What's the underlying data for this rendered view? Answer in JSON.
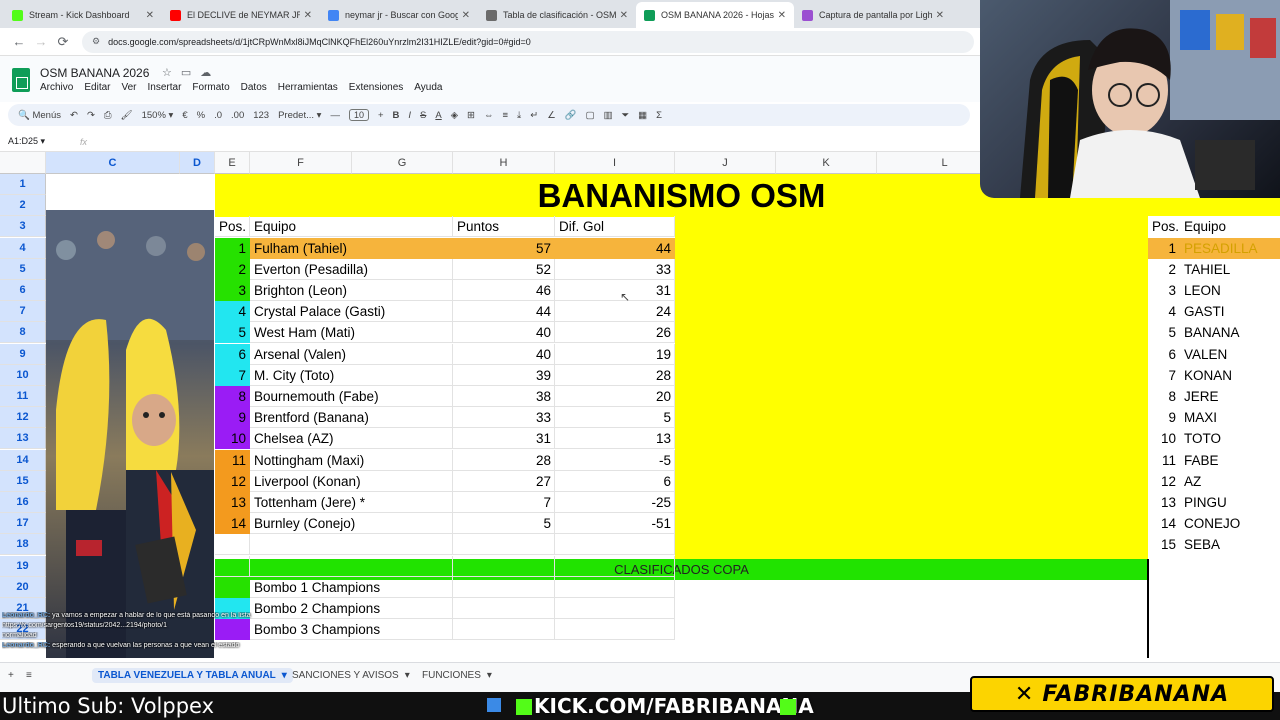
{
  "browser": {
    "tabs": [
      {
        "label": "Stream - Kick Dashboard",
        "color": "#53fc18",
        "active": false
      },
      {
        "label": "El DECLIVE de NEYMAR JR 😱",
        "color": "#ff0000",
        "active": false
      },
      {
        "label": "neymar jr - Buscar con Google",
        "color": "#4285f4",
        "active": false
      },
      {
        "label": "Tabla de clasificación - OSM",
        "color": "#6b6b6b",
        "active": false
      },
      {
        "label": "OSM BANANA 2026 - Hojas de",
        "color": "#0f9d58",
        "active": true
      },
      {
        "label": "Captura de pantalla por Lightsh",
        "color": "#9b4fd1",
        "active": false
      }
    ],
    "url": "docs.google.com/spreadsheets/d/1jtCRpWnMxl8iJMqClNKQFhEl260uYnrzlm2I31HIZLE/edit?gid=0#gid=0"
  },
  "doc": {
    "title": "OSM BANANA 2026",
    "menu": [
      "Archivo",
      "Editar",
      "Ver",
      "Insertar",
      "Formato",
      "Datos",
      "Herramientas",
      "Extensiones",
      "Ayuda"
    ]
  },
  "toolbar": {
    "menus_label": "Menús",
    "zoom": "150%",
    "currency": "€",
    "percent": "%",
    "dec_less": ".0",
    "dec_more": ".00",
    "number_format": "123",
    "font": "Predet...",
    "font_size": "10"
  },
  "formula": {
    "namebox": "A1:D25",
    "fx": "fx"
  },
  "columns": [
    "C",
    "D",
    "E",
    "F",
    "G",
    "H",
    "I",
    "J",
    "K",
    "L"
  ],
  "rows": [
    "1",
    "2",
    "3",
    "4",
    "5",
    "6",
    "7",
    "8",
    "9",
    "10",
    "11",
    "12",
    "13",
    "14",
    "15",
    "16",
    "17",
    "18",
    "19",
    "20",
    "21",
    "22"
  ],
  "sheet": {
    "banner": "BANANISMO OSM",
    "headers": {
      "pos": "Pos.",
      "team": "Equipo",
      "points": "Puntos",
      "goal_diff": "Dif. Gol"
    },
    "standings": [
      {
        "pos": "1",
        "team": "Fulham (Tahiel)",
        "points": "57",
        "gd": "44",
        "color": "#26e100"
      },
      {
        "pos": "2",
        "team": "Everton (Pesadilla)",
        "points": "52",
        "gd": "33",
        "color": "#26e100"
      },
      {
        "pos": "3",
        "team": "Brighton (Leon)",
        "points": "46",
        "gd": "31",
        "color": "#26e100"
      },
      {
        "pos": "4",
        "team": "Crystal Palace (Gasti)",
        "points": "44",
        "gd": "24",
        "color": "#22e6f0"
      },
      {
        "pos": "5",
        "team": "West Ham (Mati)",
        "points": "40",
        "gd": "26",
        "color": "#22e6f0"
      },
      {
        "pos": "6",
        "team": "Arsenal (Valen)",
        "points": "40",
        "gd": "19",
        "color": "#22e6f0"
      },
      {
        "pos": "7",
        "team": "M. City (Toto)",
        "points": "39",
        "gd": "28",
        "color": "#22e6f0"
      },
      {
        "pos": "8",
        "team": "Bournemouth (Fabe)",
        "points": "38",
        "gd": "20",
        "color": "#9a1cf5"
      },
      {
        "pos": "9",
        "team": "Brentford (Banana)",
        "points": "33",
        "gd": "5",
        "color": "#9a1cf5"
      },
      {
        "pos": "10",
        "team": "Chelsea (AZ)",
        "points": "31",
        "gd": "13",
        "color": "#9a1cf5"
      },
      {
        "pos": "11",
        "team": "Nottingham (Maxi)",
        "points": "28",
        "gd": "-5",
        "color": "#f39a1e"
      },
      {
        "pos": "12",
        "team": "Liverpool (Konan)",
        "points": "27",
        "gd": "6",
        "color": "#f39a1e"
      },
      {
        "pos": "13",
        "team": "Tottenham (Jere) *",
        "points": "7",
        "gd": "-25",
        "color": "#f39a1e"
      },
      {
        "pos": "14",
        "team": "Burnley (Conejo)",
        "points": "5",
        "gd": "-51",
        "color": "#f39a1e"
      }
    ],
    "ranking_headers": {
      "pos": "Pos.",
      "team": "Equipo"
    },
    "ranking": [
      {
        "pos": "1",
        "name": "PESADILLA"
      },
      {
        "pos": "2",
        "name": "TAHIEL"
      },
      {
        "pos": "3",
        "name": "LEON"
      },
      {
        "pos": "4",
        "name": "GASTI"
      },
      {
        "pos": "5",
        "name": "BANANA"
      },
      {
        "pos": "6",
        "name": "VALEN"
      },
      {
        "pos": "7",
        "name": "KONAN"
      },
      {
        "pos": "8",
        "name": "JERE"
      },
      {
        "pos": "9",
        "name": "MAXI"
      },
      {
        "pos": "10",
        "name": "TOTO"
      },
      {
        "pos": "11",
        "name": "FABE"
      },
      {
        "pos": "12",
        "name": "AZ"
      },
      {
        "pos": "13",
        "name": "PINGU"
      },
      {
        "pos": "14",
        "name": "CONEJO"
      },
      {
        "pos": "15",
        "name": "SEBA"
      }
    ],
    "copa_title": "CLASIFICADOS COPA",
    "copa_rows": [
      {
        "label": "Bombo 1 Champions",
        "color": "#26e100"
      },
      {
        "label": "Bombo 2 Champions",
        "color": "#22e6f0"
      },
      {
        "label": "Bombo 3 Champions",
        "color": "#9a1cf5"
      }
    ]
  },
  "sheet_tabs": [
    {
      "label": "TABLA VENEZUELA Y TABLA ANUAL",
      "active": true
    },
    {
      "label": "SANCIONES Y AVISOS",
      "active": false
    },
    {
      "label": "FUNCIONES",
      "active": false
    }
  ],
  "stream": {
    "last_sub": "Ultimo Sub: Volppex",
    "kick_url": "KICK.COM/FABRIBANANA",
    "brand": "FABRIBANANA",
    "chat": [
      {
        "user": "Leonardo_RC:",
        "text": "ya vamos a empezar a hablar de lo que está pasando en la lista"
      },
      {
        "user": "",
        "text": "https://x.com/sargentos19/status/2042...2194/photo/1"
      },
      {
        "user": "",
        "text": "normalidad"
      },
      {
        "user": "Leonardo_RC:",
        "text": "esperando a que vuelvan las personas a que vean el estado"
      }
    ]
  },
  "colors": {
    "yellow": "#ffff00",
    "highlight": "#f6b43c",
    "copa": "#21e300",
    "sheets_green": "#0f9d58",
    "kick_green": "#53fc18",
    "brand_yellow": "#fcd400"
  }
}
